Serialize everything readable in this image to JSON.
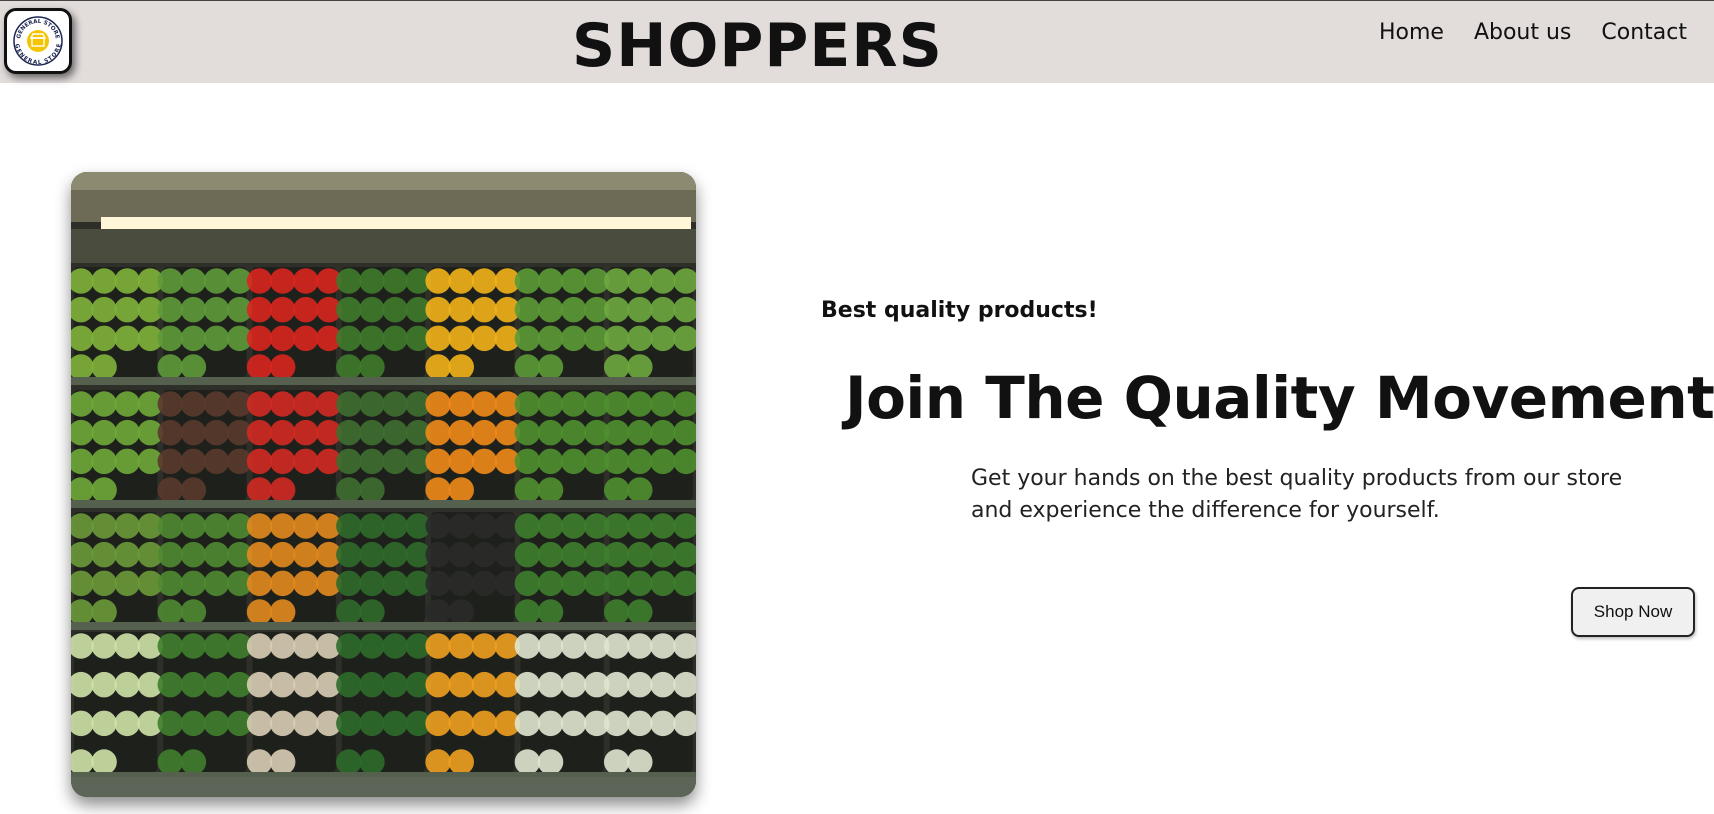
{
  "header": {
    "brand": "SHOPPERS",
    "logo": {
      "icon": "store-badge-logo",
      "text_top": "GENERAL STORE",
      "text_bottom": "GENERAL STORE",
      "accent": "#f5c400"
    },
    "nav": [
      {
        "label": "Home"
      },
      {
        "label": "About us"
      },
      {
        "label": "Contact"
      }
    ]
  },
  "hero": {
    "image": "supermarket-vegetable-shelves",
    "tagline": "Best quality products!",
    "headline": "Join The Quality Movement",
    "description": "Get your hands on the best quality products from our store and experience the difference for yourself.",
    "cta_label": "Shop Now"
  },
  "colors": {
    "header_bg": "#e2dcdb",
    "text": "#111111",
    "button_bg": "#f0f0f0"
  }
}
